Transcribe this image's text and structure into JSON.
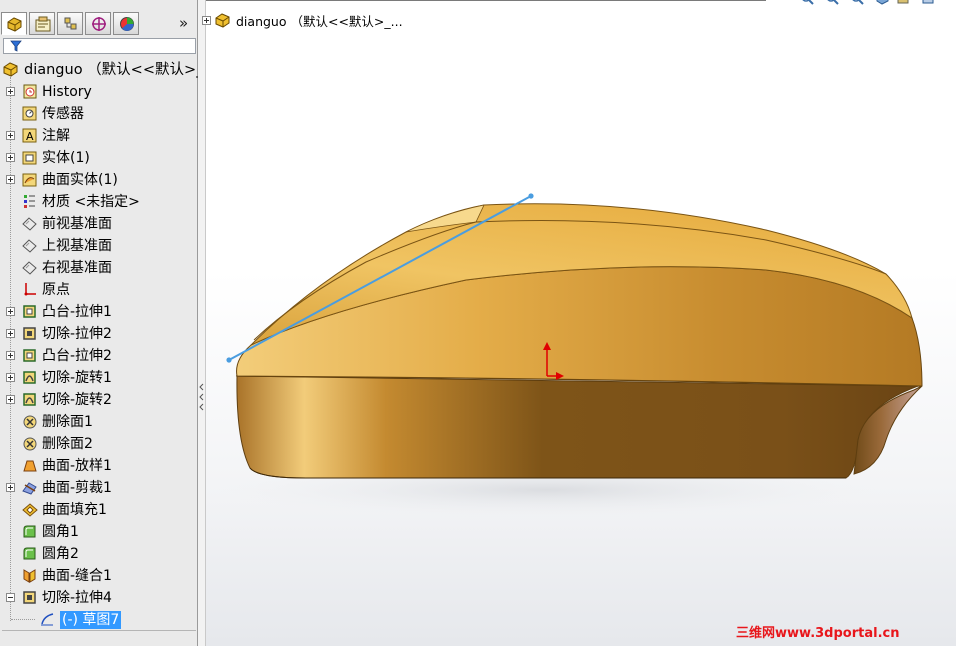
{
  "panel": {
    "tabs": [
      "feature-manager",
      "property-manager",
      "configuration-manager",
      "dimxpert-manager",
      "display-manager"
    ],
    "more_label": "»"
  },
  "tree": {
    "root": "dianguo （默认<<默认>_",
    "items": [
      {
        "label": "History",
        "icon": "history-icon",
        "expandable": true
      },
      {
        "label": "传感器",
        "icon": "sensor-icon",
        "expandable": false
      },
      {
        "label": "注解",
        "icon": "annotation-icon",
        "expandable": true
      },
      {
        "label": "实体(1)",
        "icon": "solid-bodies-icon",
        "expandable": true
      },
      {
        "label": "曲面实体(1)",
        "icon": "surface-bodies-icon",
        "expandable": true
      },
      {
        "label": "材质 <未指定>",
        "icon": "material-icon",
        "expandable": false
      },
      {
        "label": "前视基准面",
        "icon": "plane-icon",
        "expandable": false
      },
      {
        "label": "上视基准面",
        "icon": "plane-icon",
        "expandable": false
      },
      {
        "label": "右视基准面",
        "icon": "plane-icon",
        "expandable": false
      },
      {
        "label": "原点",
        "icon": "origin-icon",
        "expandable": false
      },
      {
        "label": "凸台-拉伸1",
        "icon": "boss-extrude-icon",
        "expandable": true
      },
      {
        "label": "切除-拉伸2",
        "icon": "cut-extrude-icon",
        "expandable": true
      },
      {
        "label": "凸台-拉伸2",
        "icon": "boss-extrude-icon",
        "expandable": true
      },
      {
        "label": "切除-旋转1",
        "icon": "cut-revolve-icon",
        "expandable": true
      },
      {
        "label": "切除-旋转2",
        "icon": "cut-revolve-icon",
        "expandable": true
      },
      {
        "label": "删除面1",
        "icon": "delete-face-icon",
        "expandable": false
      },
      {
        "label": "删除面2",
        "icon": "delete-face-icon",
        "expandable": false
      },
      {
        "label": "曲面-放样1",
        "icon": "surface-loft-icon",
        "expandable": false
      },
      {
        "label": "曲面-剪裁1",
        "icon": "surface-trim-icon",
        "expandable": true
      },
      {
        "label": "曲面填充1",
        "icon": "surface-fill-icon",
        "expandable": false
      },
      {
        "label": "圆角1",
        "icon": "fillet-icon",
        "expandable": false
      },
      {
        "label": "圆角2",
        "icon": "fillet-icon",
        "expandable": false
      },
      {
        "label": "曲面-缝合1",
        "icon": "surface-knit-icon",
        "expandable": false
      },
      {
        "label": "切除-拉伸4",
        "icon": "cut-extrude-icon",
        "expandable": true,
        "expanded": true
      },
      {
        "label": "(-) 草图7",
        "icon": "sketch-icon",
        "expandable": false,
        "selected": true,
        "child": true
      }
    ]
  },
  "viewport": {
    "tree_label": "dianguo （默认<<默认>_...",
    "view_tools": [
      "zoom-to-fit-icon",
      "zoom-area-icon",
      "previous-view-icon",
      "section-view-icon",
      "view-orientation-icon",
      "display-style-icon"
    ],
    "watermark": "三维网www.3dportal.cn"
  },
  "colors": {
    "panel_bg": "#eaeaea",
    "selection": "#3399ff",
    "model_gold": "#d9a23c",
    "sketch_line": "#4a9de0",
    "watermark": "#e8161b"
  }
}
